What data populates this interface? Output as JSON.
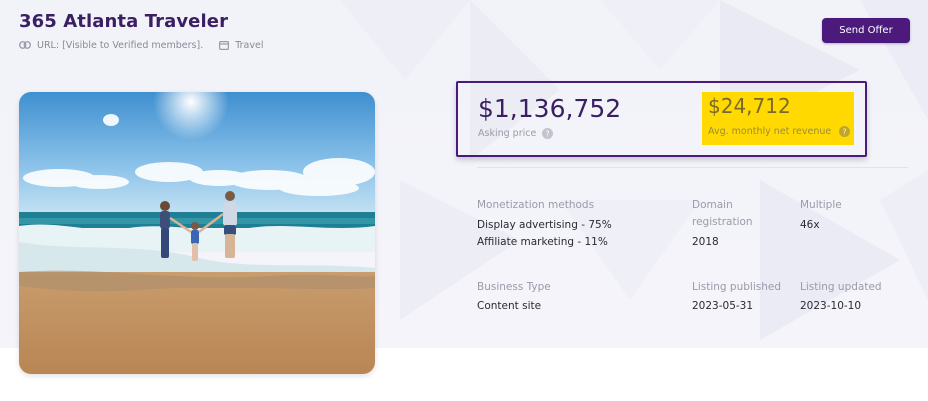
{
  "listing": {
    "title": "365 Atlanta Traveler",
    "url_text": "URL: [Visible to Verified members].",
    "category": "Travel"
  },
  "actions": {
    "send_offer": "Send Offer"
  },
  "pricing": {
    "asking_price_value": "$1,136,752",
    "asking_price_label": "Asking price",
    "revenue_value": "$24,712",
    "revenue_label": "Avg. monthly net revenue"
  },
  "details": {
    "monetization": {
      "label": "Monetization methods",
      "items": [
        "Display advertising - 75%",
        "Affiliate marketing - 11%"
      ]
    },
    "domain_registration": {
      "label_line1": "Domain",
      "label_line2": "registration",
      "value": "2018"
    },
    "multiple": {
      "label": "Multiple",
      "value": "46x"
    },
    "business_type": {
      "label": "Business Type",
      "value": "Content site"
    },
    "listing_published": {
      "label": "Listing published",
      "value": "2023-05-31"
    },
    "listing_updated": {
      "label": "Listing updated",
      "value": "2023-10-10"
    }
  },
  "icons": [
    "link-icon",
    "browser-window-icon",
    "help-circle-icon"
  ],
  "colors": {
    "brand_purple": "#4c1a7c",
    "title_purple": "#3b1f63",
    "highlight_yellow": "#ffd900",
    "hero_background": "#f2f2f9"
  }
}
